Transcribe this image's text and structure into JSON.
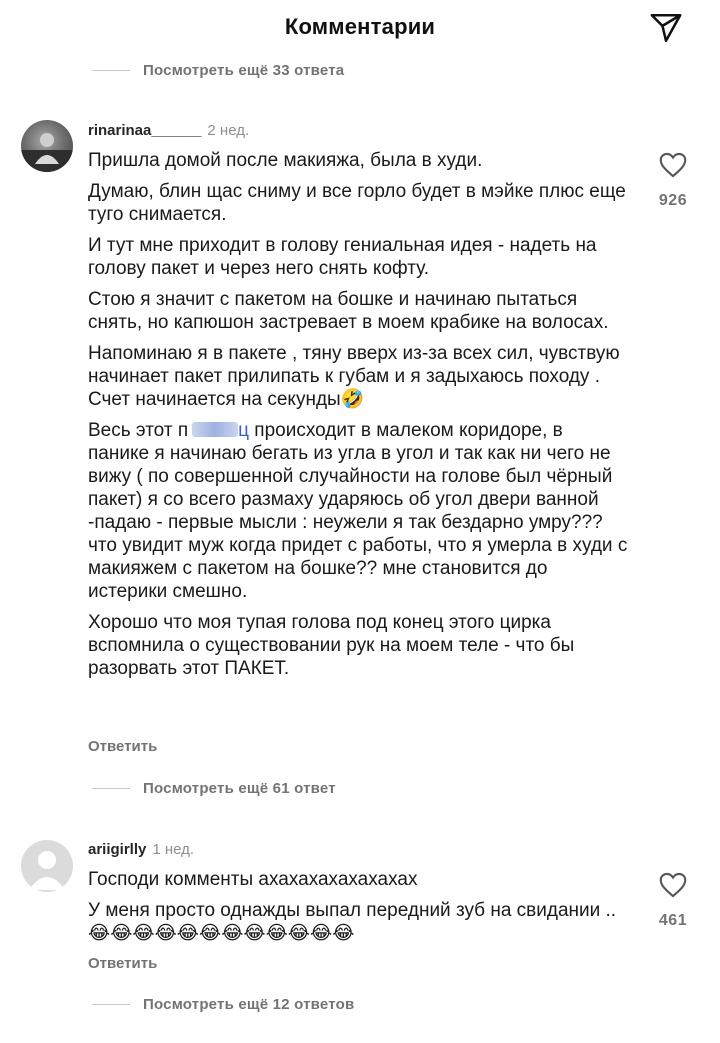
{
  "header": {
    "title": "Комментарии",
    "share_icon": "send-icon"
  },
  "more_replies_top": "Посмотреть ещё 33 ответа",
  "comments": [
    {
      "username": "rinarinaa______",
      "time": "2 нед.",
      "paragraphs": [
        "Пришла домой после макияжа, была в худи.",
        "Думаю, блин щас сниму и все горло будет в мэйке плюс еще туго снимается.",
        "И тут мне приходит в голову гениальная идея - надеть на голову пакет и через него снять кофту.",
        "Стою я значит с пакетом на бошке и начинаю пытаться снять, но капюшон застревает в моем крабике на волосах.",
        "Напоминаю я в пакете , тяну вверх из-за всех сил, чувствую начинает пакет прилипать к губам и я задыхаюсь походу . Счет начинается на секунды🤣"
      ],
      "paragraph6_start": "Весь этот п",
      "paragraph6_censor_end": "ц",
      "paragraph6_rest": " происходит в малеком коридоре, в панике я начинаю бегать из угла в угол и так как ни чего не вижу ( по совершенной случайности на голове был чёрный пакет) я со всего размаху ударяюсь об угол двери ванной -падаю - первые мысли : неужели я так бездарно умру??? что увидит муж когда придет с работы, что я  умерла в худи с макияжем с пакетом на бошке?? мне становится до истерики смешно.",
      "paragraph7": "Хорошо что моя тупая голова под конец этого цирка вспомнила о существовании рук на моем теле - что бы разорвать этот ПАКЕТ.",
      "reply_label": "Ответить",
      "likes": "926",
      "more_replies": "Посмотреть ещё 61 ответ"
    },
    {
      "username": "ariigirlly",
      "time": "1 нед.",
      "paragraphs": [
        "Господи комменты ахахахахахахахах",
        "У меня просто однажды выпал передний зуб на свидании .. 😂😂😂😂😂😂😂😂😂😂😂😂"
      ],
      "reply_label": "Ответить",
      "likes": "461",
      "more_replies": "Посмотреть ещё 12 ответов"
    }
  ],
  "colors": {
    "muted": "#737373",
    "text": "#1a1a1a",
    "meta": "#8e8e8e",
    "divider": "#c7c7c7"
  }
}
